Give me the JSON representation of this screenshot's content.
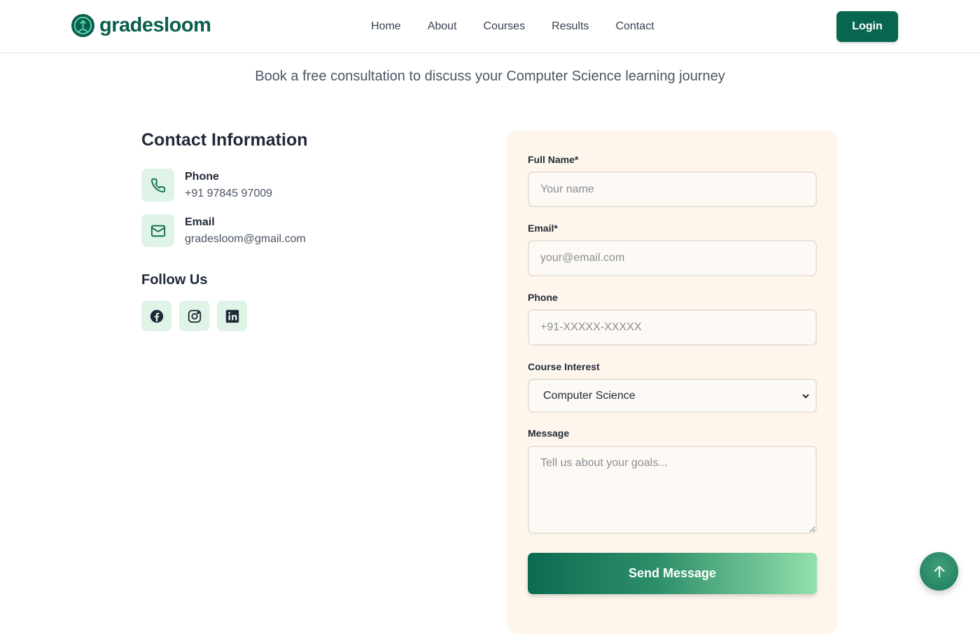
{
  "brand": {
    "name": "gradesloom",
    "color": "#06664f"
  },
  "nav": {
    "items": [
      "Home",
      "About",
      "Courses",
      "Results",
      "Contact"
    ]
  },
  "header": {
    "login_label": "Login"
  },
  "hero": {
    "subtitle": "Book a free consultation to discuss your Computer Science learning journey"
  },
  "contact_info": {
    "title": "Contact Information",
    "phone_label": "Phone",
    "phone_value": "+91 97845 97009",
    "email_label": "Email",
    "email_value": "gradesloom@gmail.com",
    "follow_title": "Follow Us",
    "socials": [
      "facebook-icon",
      "instagram-icon",
      "linkedin-icon"
    ]
  },
  "form": {
    "name_label": "Full Name*",
    "name_placeholder": "Your name",
    "email_label": "Email*",
    "email_placeholder": "your@email.com",
    "phone_label": "Phone",
    "phone_placeholder": "+91-XXXXX-XXXXX",
    "course_label": "Course Interest",
    "course_value": "Computer Science",
    "message_label": "Message",
    "message_placeholder": "Tell us about your goals...",
    "submit_label": "Send Message"
  }
}
